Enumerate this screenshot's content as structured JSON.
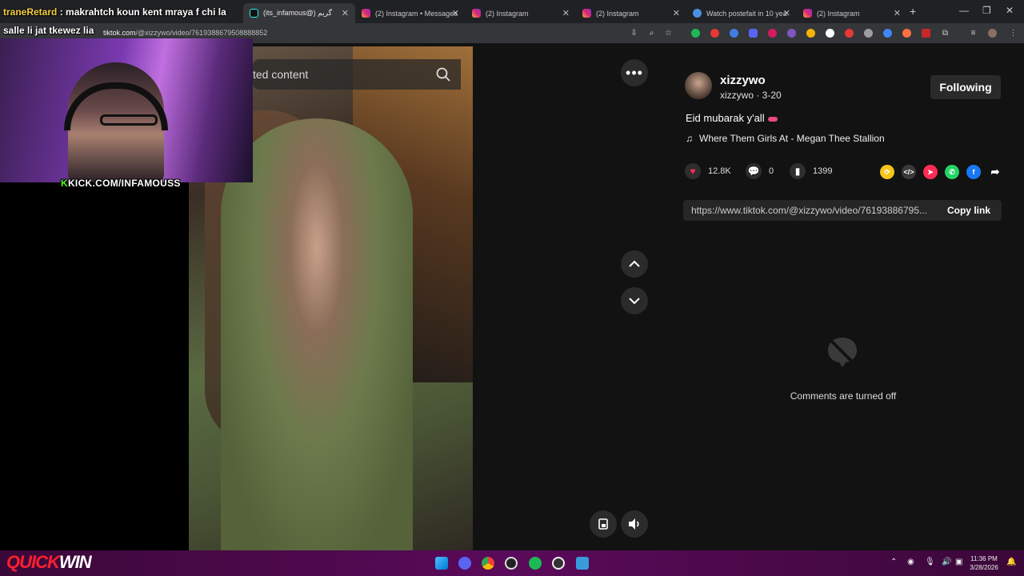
{
  "browser": {
    "tabs": [
      {
        "label": "(its_infamous@) گريم",
        "active": true
      },
      {
        "label": "(2) Instagram • Messages"
      },
      {
        "label": "(2) Instagram"
      },
      {
        "label": "(2) Instagram"
      },
      {
        "label": "Watch postefait in 10 yea"
      },
      {
        "label": "(2) Instagram"
      }
    ],
    "url_host": "tiktok.com",
    "url_path": "/@xizzywo/video/7619388679508888852"
  },
  "stream_overlay": {
    "chat_user": "traneRetard",
    "chat_message_1": ": makrahtch koun kent mraya f chi la",
    "chat_message_2": "salle li jat tkewez lia",
    "kick_prefix": "K",
    "kick_text": "KICK.COM/INFAMOUSS",
    "brand_red": "QUICK",
    "brand_white": "WIN"
  },
  "video": {
    "search_placeholder": "ted content",
    "more_label": "•••"
  },
  "post": {
    "username": "xizzywo",
    "handle_date": "xizzywo · 3-20",
    "follow_label": "Following",
    "caption": "Eid mubarak y'all",
    "music": "Where Them Girls At - Megan Thee Stallion",
    "likes": "12.8K",
    "comments": "0",
    "saves": "1399",
    "link": "https://www.tiktok.com/@xizzywo/video/76193886795...",
    "copy_label": "Copy link",
    "comments_off": "Comments are turned off"
  },
  "taskbar": {
    "time": "11:36 PM",
    "date": "3/28/2026"
  },
  "colors": {
    "like_red": "#fe2c55",
    "kick_green": "#53fc18",
    "taskbar_purple": "#5a0a5a"
  }
}
